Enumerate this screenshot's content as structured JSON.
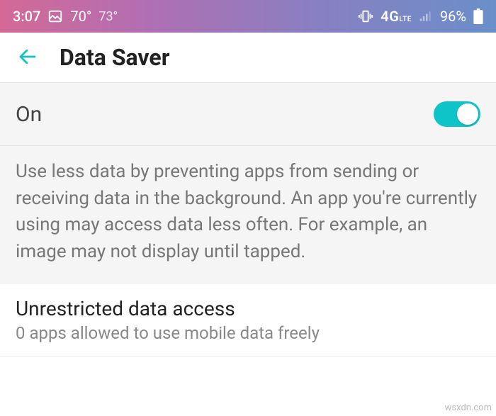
{
  "statusbar": {
    "time": "3:07",
    "temp1": "70°",
    "temp2": "73°",
    "network": "4G",
    "battery": "96%"
  },
  "appbar": {
    "title": "Data Saver"
  },
  "toggle": {
    "label": "On",
    "state": "on"
  },
  "description": "Use less data by preventing apps from sending or receiving data in the background. An app you're currently using may access data less often. For example, an image may not display until tapped.",
  "item": {
    "title": "Unrestricted data access",
    "subtitle": "0 apps allowed to use mobile data freely"
  },
  "watermark": "wsxdn.com"
}
